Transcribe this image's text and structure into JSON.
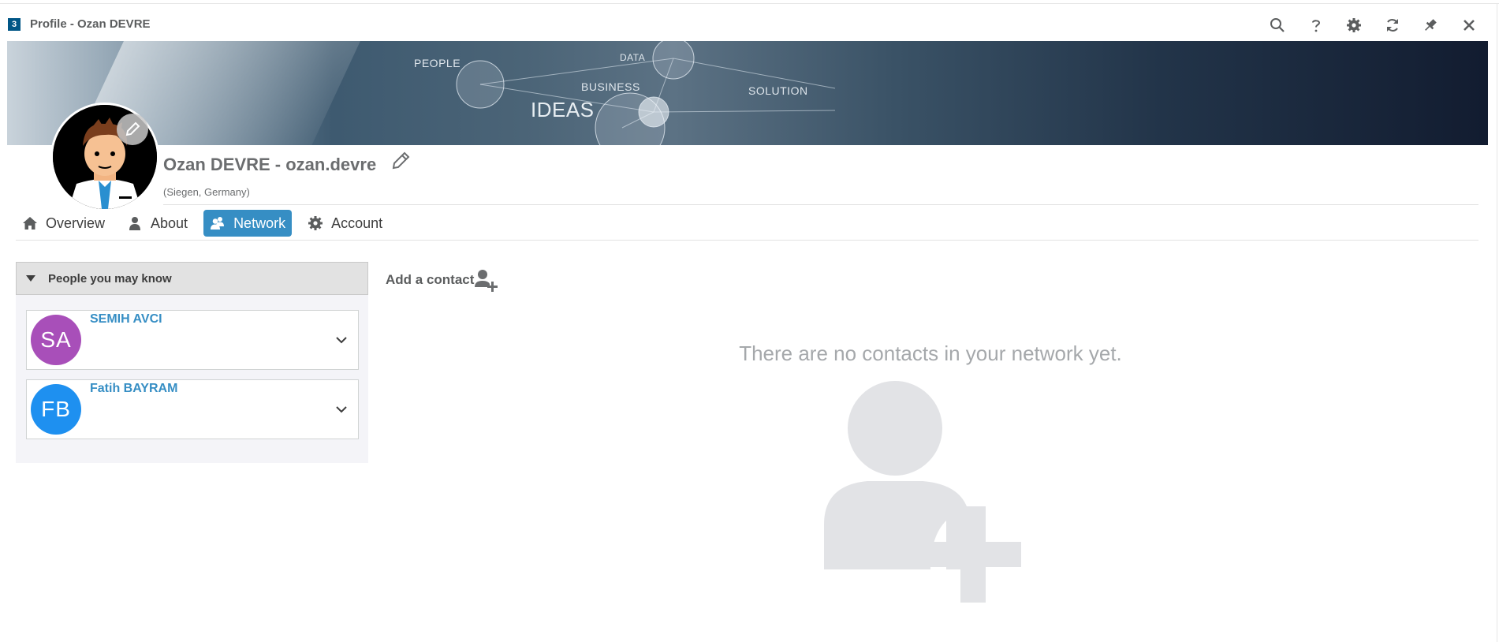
{
  "window": {
    "title": "Profile - Ozan DEVRE",
    "app_icon": "3ds-compass-icon",
    "toolbar": [
      "search-icon",
      "help-icon",
      "gear-icon",
      "refresh-icon",
      "pin-icon",
      "close-icon"
    ]
  },
  "banner": {
    "words": [
      "PEOPLE",
      "DATA",
      "BUSINESS",
      "SOLUTION",
      "IDEAS"
    ]
  },
  "profile": {
    "name": "Ozan DEVRE - ozan.devre",
    "location": "(Siegen, Germany)"
  },
  "tabs": [
    {
      "label": "Overview",
      "icon": "home-icon"
    },
    {
      "label": "About",
      "icon": "user-icon"
    },
    {
      "label": "Network",
      "icon": "users-icon",
      "active": true
    },
    {
      "label": "Account",
      "icon": "gear-icon"
    }
  ],
  "suggestions": {
    "title": "People you may know",
    "people": [
      {
        "initials": "SA",
        "name": "SEMIH AVCI",
        "color": "#a84fb9"
      },
      {
        "initials": "FB",
        "name": "Fatih BAYRAM",
        "color": "#1e90f0"
      }
    ]
  },
  "network": {
    "add_contact_label": "Add a contact",
    "empty_message": "There are no contacts in your network yet."
  },
  "colors": {
    "accent": "#368ec4",
    "muted_text": "#a5a8ab",
    "illustration": "#e2e3e6"
  }
}
